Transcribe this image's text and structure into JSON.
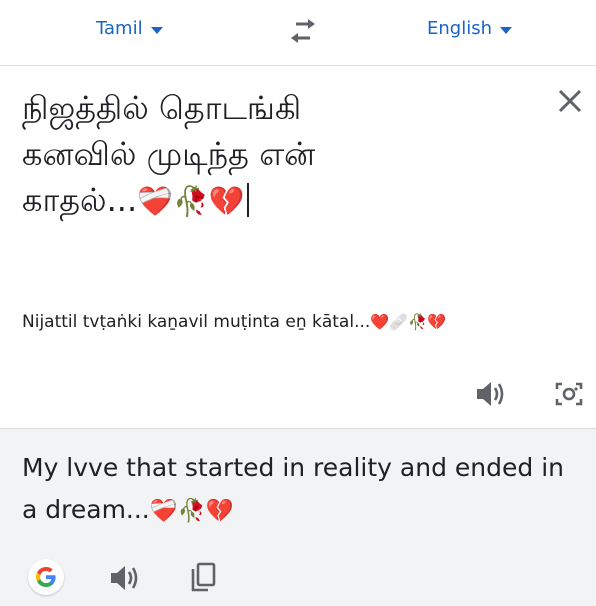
{
  "language_bar": {
    "source_language": "Tamil",
    "target_language": "English"
  },
  "source": {
    "line1": "நிஜத்தில் தொடங்கி",
    "line2": "கனவில் முடிந்த என்",
    "line3": "காதல்...",
    "line3_emoji": "❤️‍🩹🥀💔",
    "transliteration": "Nijattil tvṭaṅki kaṉavil muṭinta eṉ kātal...",
    "transliteration_emoji": "❤️🩹🥀💔"
  },
  "target": {
    "translation": "My lvve that started in reality and ended in a dream...",
    "translation_emoji": "❤️‍🩹🥀💔"
  },
  "icons": {
    "swap": "swap-arrows-icon",
    "close": "close-icon",
    "speaker": "speaker-icon",
    "camera": "camera-icon",
    "google": "google-logo-icon",
    "copy": "copy-icon"
  },
  "colors": {
    "accent": "#1a63c7",
    "icon": "#5f6368",
    "result_background": "#f1f3f4"
  }
}
